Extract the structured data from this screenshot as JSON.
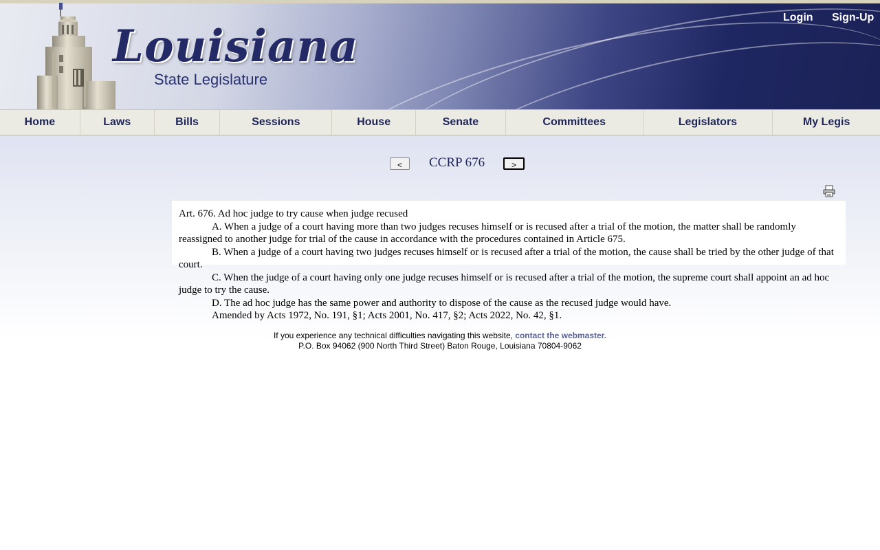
{
  "header": {
    "logo_title": "Louisiana",
    "logo_subtitle": "State Legislature",
    "login_label": "Login",
    "signup_label": "Sign-Up"
  },
  "nav": {
    "items": [
      "Home",
      "Laws",
      "Bills",
      "Sessions",
      "House",
      "Senate",
      "Committees",
      "Legislators",
      "My Legis"
    ]
  },
  "pager": {
    "prev_label": "<",
    "next_label": ">",
    "title": "CCRP 676"
  },
  "law": {
    "heading": "Art. 676. Ad hoc judge to try cause when judge recused",
    "paragraphs": [
      "A. When a judge of a court having more than two judges recuses himself or is recused after a trial of the motion, the matter shall be randomly reassigned to another judge for trial of the cause in accordance with the procedures contained in Article 675.",
      "B. When a judge of a court having two judges recuses himself or is recused after a trial of the motion, the cause shall be tried by the other judge of that court.",
      "C. When the judge of a court having only one judge recuses himself or is recused after a trial of the motion, the supreme court shall appoint an ad hoc judge to try the cause.",
      "D. The ad hoc judge has the same power and authority to dispose of the cause as the recused judge would have.",
      "Amended by Acts 1972, No. 191, §1; Acts 2001, No. 417, §2; Acts 2022, No. 42, §1."
    ]
  },
  "footer": {
    "line1_text": "If you experience any technical difficulties navigating this website,",
    "line1_link": "contact the webmaster.",
    "line2": "P.O. Box 94062 (900 North Third Street) Baton Rouge, Louisiana 70804-9062"
  },
  "icons": {
    "print": "printer-icon"
  }
}
